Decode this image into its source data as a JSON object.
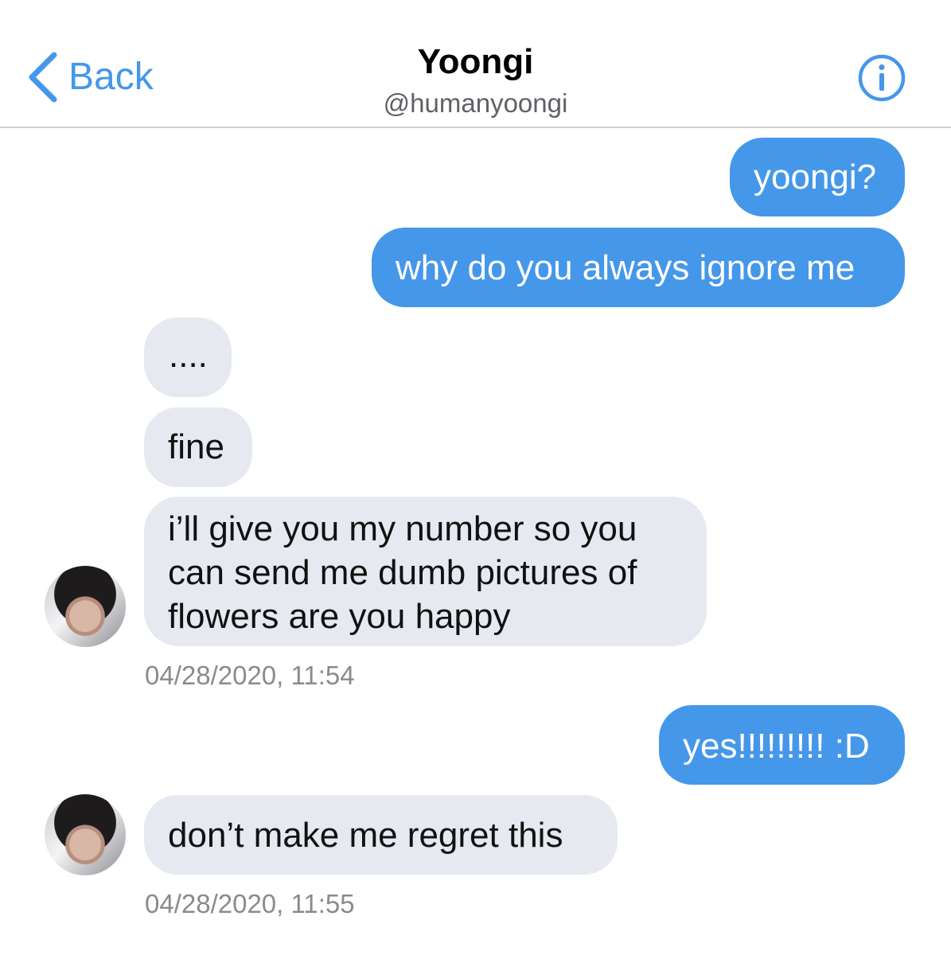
{
  "header": {
    "back_label": "Back",
    "title": "Yoongi",
    "handle": "@humanyoongi",
    "back_icon": "chevron-left-icon",
    "info_icon": "info-icon"
  },
  "colors": {
    "accent": "#4597e9",
    "sent_bubble": "#4597e9",
    "received_bubble": "#e6e9ef",
    "timestamp": "#8a8a8f"
  },
  "messages": [
    {
      "from": "me",
      "text": "yoongi?"
    },
    {
      "from": "me",
      "text": "why do you always ignore me"
    },
    {
      "from": "them",
      "text": "...."
    },
    {
      "from": "them",
      "text": "fine"
    },
    {
      "from": "them",
      "lines": [
        "i’ll give you my number so you",
        "can send me dumb pictures of",
        "flowers are you happy"
      ]
    },
    {
      "from": "me",
      "text": "yes!!!!!!!!! :D"
    },
    {
      "from": "them",
      "text": "don’t make me regret this"
    }
  ],
  "timestamps": [
    "04/28/2020, 11:54",
    "04/28/2020, 11:55"
  ]
}
